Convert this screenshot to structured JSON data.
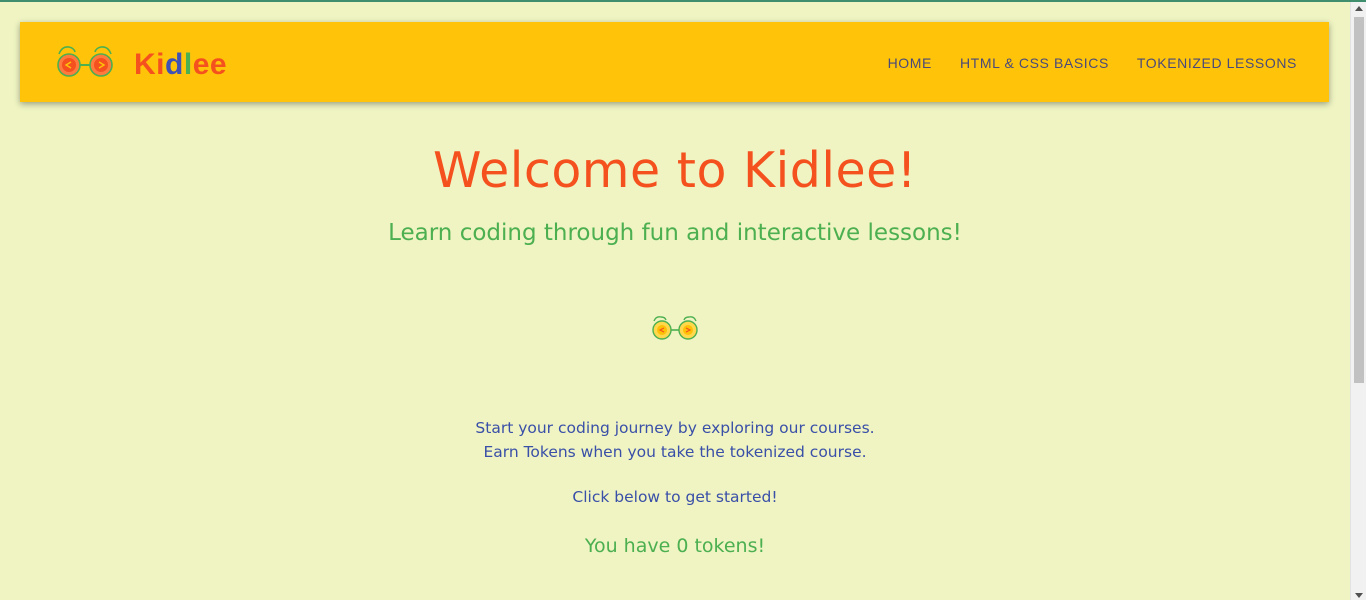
{
  "header": {
    "brand": {
      "letters": [
        {
          "char": "K",
          "color": "#f4511e"
        },
        {
          "char": "i",
          "color": "#f4511e"
        },
        {
          "char": "d",
          "color": "#3f51b5"
        },
        {
          "char": "l",
          "color": "#4caf50"
        },
        {
          "char": "e",
          "color": "#f4511e"
        },
        {
          "char": "e",
          "color": "#f4511e"
        }
      ],
      "logo_icon": "goggles-logo-icon"
    },
    "nav": [
      {
        "label": "HOME"
      },
      {
        "label": "HTML & CSS BASICS"
      },
      {
        "label": "TOKENIZED LESSONS"
      }
    ],
    "background": "#ffc40a"
  },
  "main": {
    "title": "Welcome to Kidlee!",
    "subtitle": "Learn coding through fun and interactive lessons!",
    "center_icon": "goggles-logo-icon",
    "intro_line_1": "Start your coding journey by exploring our courses.",
    "intro_line_2": "Earn Tokens when you take the tokenized course.",
    "cta": "Click below to get started!",
    "tokens_message": "You have 0 tokens!"
  },
  "colors": {
    "page_background": "#eff4c2",
    "title": "#f4511e",
    "subtitle": "#4caf50",
    "body_text": "#3a4fa8",
    "nav_text": "#4a4a7a"
  }
}
